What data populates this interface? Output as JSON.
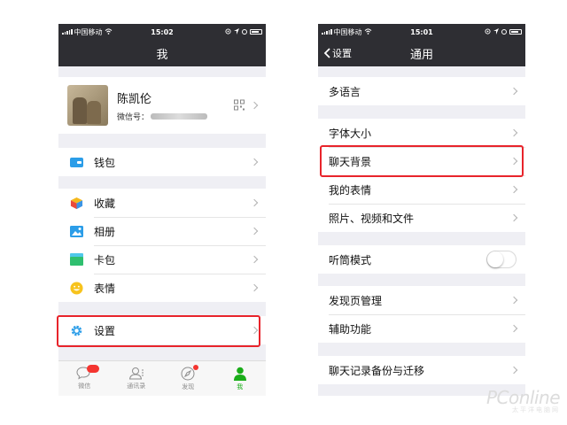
{
  "left": {
    "status": {
      "carrier": "中国移动",
      "time": "15:02"
    },
    "title": "我",
    "profile": {
      "name": "陈凯伦",
      "id_label": "微信号："
    },
    "wallet": "钱包",
    "items": [
      "收藏",
      "相册",
      "卡包",
      "表情"
    ],
    "settings": "设置",
    "tabs": [
      "微信",
      "通讯录",
      "发现",
      "我"
    ]
  },
  "right": {
    "status": {
      "carrier": "中国移动",
      "time": "15:01"
    },
    "back": "设置",
    "title": "通用",
    "language": "多语言",
    "group2": [
      "字体大小",
      "聊天背景",
      "我的表情",
      "照片、视频和文件"
    ],
    "listen_mode": "听筒模式",
    "group4": [
      "发现页管理",
      "辅助功能"
    ],
    "backup": "聊天记录备份与迁移"
  },
  "watermark": {
    "logo": "PConline",
    "sub": "太平洋电脑网"
  },
  "colors": {
    "navbar": "#2e2e33",
    "accent_green": "#1aad19",
    "highlight_red": "#e8242b",
    "background": "#efeff4"
  },
  "toggles": {
    "listen_mode_on": false
  },
  "tab_badges": {
    "chats": true,
    "discover": true
  }
}
